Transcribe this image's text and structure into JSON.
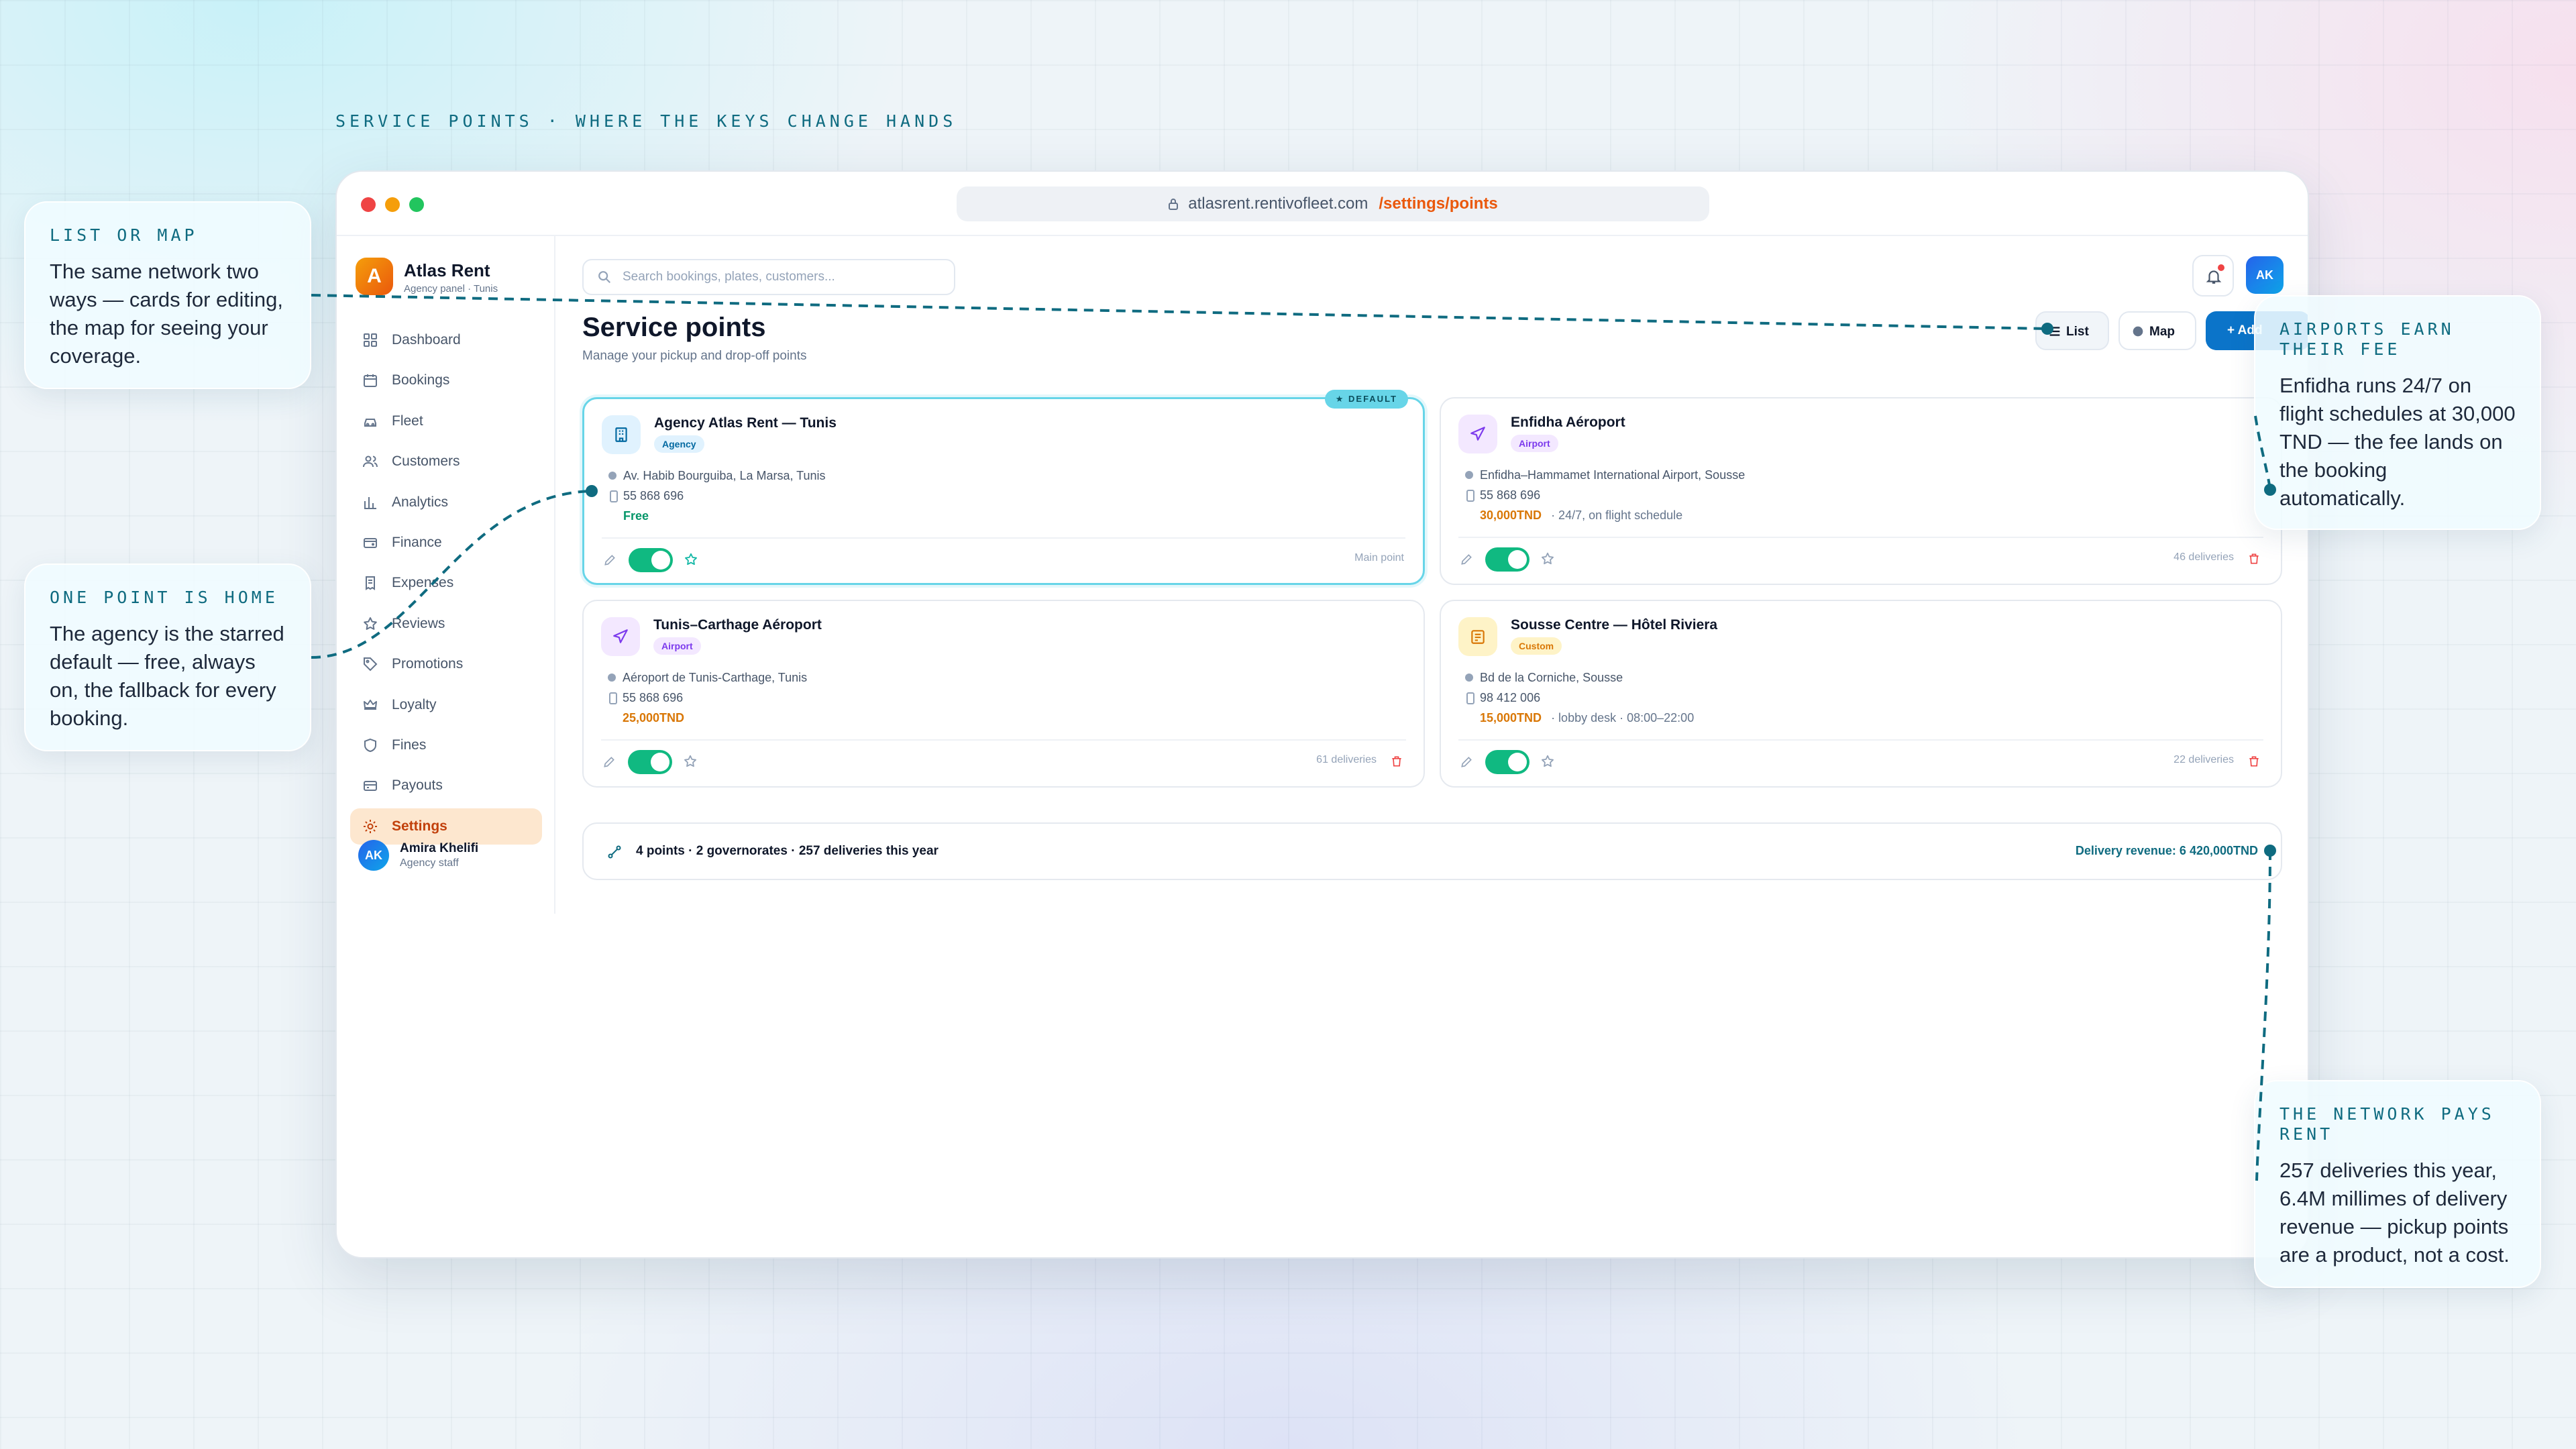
{
  "eyebrow": "SERVICE POINTS · WHERE THE KEYS CHANGE HANDS",
  "browser": {
    "url_host": "atlasrent.rentivofleet.com",
    "url_path": "/settings/points"
  },
  "brand": {
    "logo_letter": "A",
    "name": "Atlas Rent",
    "subtitle": "Agency panel · Tunis"
  },
  "nav": [
    {
      "label": "Dashboard",
      "icon": "grid-icon"
    },
    {
      "label": "Bookings",
      "icon": "calendar-icon"
    },
    {
      "label": "Fleet",
      "icon": "car-icon"
    },
    {
      "label": "Customers",
      "icon": "users-icon"
    },
    {
      "label": "Analytics",
      "icon": "bar-chart-icon"
    },
    {
      "label": "Finance",
      "icon": "wallet-icon"
    },
    {
      "label": "Expenses",
      "icon": "receipt-icon"
    },
    {
      "label": "Reviews",
      "icon": "star-icon"
    },
    {
      "label": "Promotions",
      "icon": "tag-icon"
    },
    {
      "label": "Loyalty",
      "icon": "crown-icon"
    },
    {
      "label": "Fines",
      "icon": "shield-icon"
    },
    {
      "label": "Payouts",
      "icon": "card-icon"
    },
    {
      "label": "Settings",
      "icon": "gear-icon",
      "active": true
    }
  ],
  "user": {
    "initials": "AK",
    "name": "Amira Khelifi",
    "role": "Agency staff"
  },
  "search": {
    "placeholder": "Search bookings, plates, customers..."
  },
  "header": {
    "avatar_initials": "AK"
  },
  "page": {
    "title": "Service points",
    "subtitle": "Manage your pickup and drop-off points"
  },
  "view_toggle": {
    "list_label": "List",
    "map_label": "Map",
    "add_label": "+ Add"
  },
  "cards": [
    {
      "name": "Agency Atlas Rent — Tunis",
      "tag": "Agency",
      "address": "Av. Habib Bourguiba, La Marsa, Tunis",
      "phone": "55 868 696",
      "price": "Free",
      "note": "",
      "footer": "Main point",
      "default_badge": "★ DEFAULT",
      "enabled": true
    },
    {
      "name": "Enfidha Aéroport",
      "tag": "Airport",
      "address": "Enfidha–Hammamet International Airport, Sousse",
      "phone": "55 868 696",
      "price": "30,000TND",
      "note": "· 24/7, on flight schedule",
      "footer": "46 deliveries",
      "enabled": true
    },
    {
      "name": "Tunis–Carthage Aéroport",
      "tag": "Airport",
      "address": "Aéroport de Tunis-Carthage, Tunis",
      "phone": "55 868 696",
      "price": "25,000TND",
      "note": "",
      "footer": "61 deliveries",
      "enabled": true
    },
    {
      "name": "Sousse Centre — Hôtel Riviera",
      "tag": "Custom",
      "address": "Bd de la Corniche, Sousse",
      "phone": "98 412 006",
      "price": "15,000TND",
      "note": "· lobby desk · 08:00–22:00",
      "footer": "22 deliveries",
      "enabled": true
    }
  ],
  "summary": {
    "stats": "4 points · 2 governorates · 257 deliveries this year",
    "revenue": "Delivery revenue: 6 420,000TND"
  },
  "callouts": {
    "list_map": {
      "heading": "LIST OR MAP",
      "body": "The same network two ways — cards for editing, the map for seeing your coverage."
    },
    "home": {
      "heading": "ONE POINT IS HOME",
      "body": "The agency is the starred default — free, always on, the fallback for every booking."
    },
    "airports": {
      "heading": "AIRPORTS EARN THEIR FEE",
      "body": "Enfidha runs 24/7 on flight schedules at 30,000 TND — the fee lands on the booking automatically."
    },
    "network": {
      "heading": "THE NETWORK PAYS RENT",
      "body": "257 deliveries this year, 6.4M millimes of delivery revenue — pickup points are a product, not a cost."
    }
  },
  "colors": {
    "accent": "#0b74c9",
    "callout_text": "#0f6b80",
    "active_nav": "#c2410c",
    "toggle_on": "#10b981",
    "fee": "#d97706",
    "free": "#059669"
  }
}
